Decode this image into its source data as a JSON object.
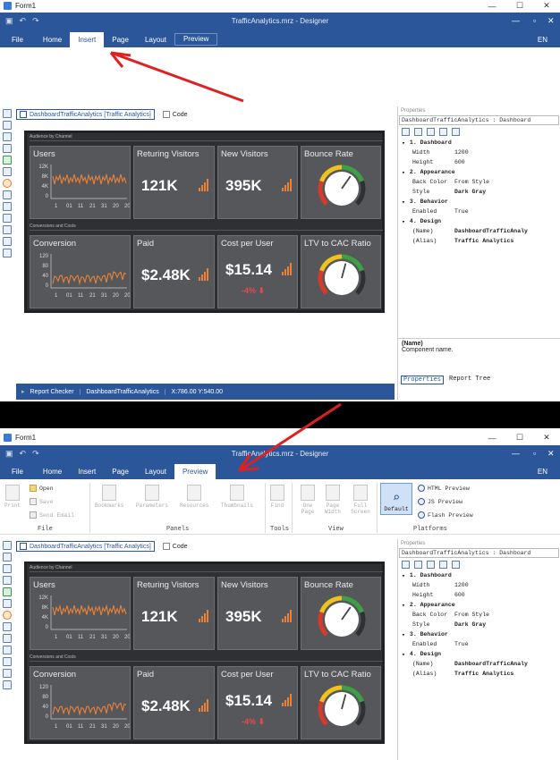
{
  "window": {
    "title": "Form1"
  },
  "ribbon": {
    "doc_title": "TrafficAnalytics.mrz - Designer",
    "tabs": [
      "File",
      "Home",
      "Insert",
      "Page",
      "Layout",
      "Preview"
    ],
    "lang": "EN"
  },
  "doc_tabs": {
    "dashboard": "DashboardTrafficAnalytics [Traffic Analytics]",
    "code": "Code"
  },
  "dashboard": {
    "section1": "Audience by Channel",
    "section2": "Conversions and Costs",
    "cards": {
      "users": {
        "title": "Users",
        "yticks": [
          "12K",
          "8K",
          "4K",
          "0"
        ]
      },
      "returning": {
        "title": "Returing Visitors",
        "value": "121K"
      },
      "new_visitors": {
        "title": "New Visitors",
        "value": "395K"
      },
      "bounce": {
        "title": "Bounce Rate"
      },
      "conversion": {
        "title": "Conversion",
        "yticks": [
          "120",
          "80",
          "40",
          "0"
        ]
      },
      "paid": {
        "title": "Paid",
        "value": "$2.48K"
      },
      "cpu": {
        "title": "Cost per User",
        "value": "$15.14",
        "delta": "-4%"
      },
      "ltv": {
        "title": "LTV to CAC Ratio"
      }
    },
    "xticks": [
      "1",
      "01",
      "11",
      "21",
      "31",
      "20",
      "20"
    ]
  },
  "properties": {
    "header": "Properties",
    "selector": "DashboardTrafficAnalytics : Dashboard",
    "rows": [
      {
        "type": "cat",
        "label": "1. Dashboard"
      },
      {
        "type": "prop",
        "key": "Width",
        "value": "1200",
        "bold": false
      },
      {
        "type": "prop",
        "key": "Height",
        "value": "600",
        "bold": false
      },
      {
        "type": "cat",
        "label": "2. Appearance"
      },
      {
        "type": "prop",
        "key": "Back Color",
        "value": "From Style",
        "bold": false
      },
      {
        "type": "prop",
        "key": "Style",
        "value": "Dark Gray",
        "bold": true
      },
      {
        "type": "cat",
        "label": "3. Behavior"
      },
      {
        "type": "prop",
        "key": "Enabled",
        "value": "True",
        "bold": false
      },
      {
        "type": "cat",
        "label": "4. Design"
      },
      {
        "type": "prop",
        "key": "(Name)",
        "value": "DashboardTrafficAnaly",
        "bold": true
      },
      {
        "type": "prop",
        "key": "(Alias)",
        "value": "Traffic Analytics",
        "bold": true
      }
    ],
    "desc_title": "(Name)",
    "desc_text": "Component name.",
    "bottom_tabs": [
      "Properties",
      "Report Tree"
    ]
  },
  "statusbar": {
    "checker": "Report Checker",
    "name": "DashboardTrafficAnalytics",
    "coords": "X:786.00 Y:540.00"
  },
  "preview_ribbon": {
    "open": "Open",
    "save": "Save",
    "send_email": "Send Email",
    "print": "Print",
    "file_group": "File",
    "panels": [
      "Bookmarks",
      "Parameters",
      "Resources",
      "Thumbnails"
    ],
    "panels_group": "Panels",
    "find": "Find",
    "tools_group": "Tools",
    "view_btns": [
      "One Page",
      "Page Width",
      "Full Screen"
    ],
    "view_group": "View",
    "default": "Default",
    "platforms": [
      "HTML Preview",
      "JS Preview",
      "Flash Preview"
    ],
    "platforms_group": "Platforms"
  },
  "colors": {
    "ribbon": "#2b579a",
    "accent": "#e8823a",
    "arrow": "#e02020"
  }
}
